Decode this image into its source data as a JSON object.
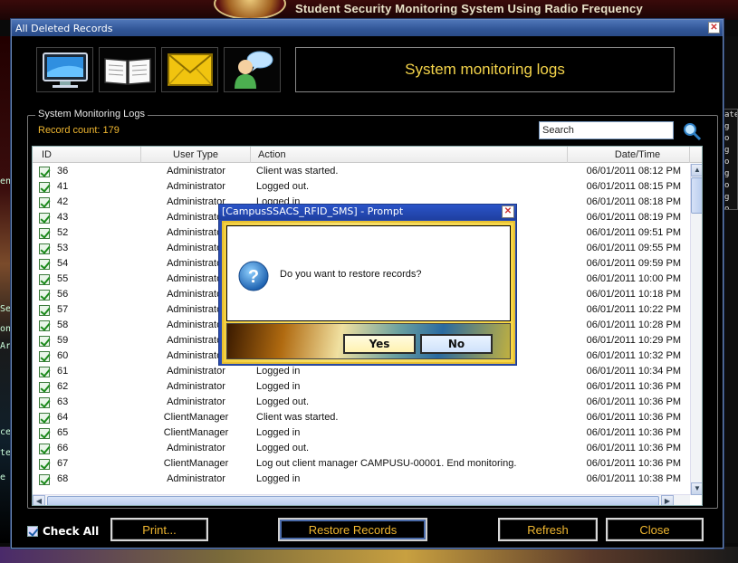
{
  "background": {
    "app_title": "Student Security Monitoring System Using Radio Frequency",
    "left_fragments": [
      "en",
      "Se",
      "on",
      "Ar",
      "ce",
      "te",
      "e"
    ],
    "right_fragments": [
      "ate",
      "g o",
      "g o",
      "g o",
      "g o",
      "g o",
      "g o"
    ]
  },
  "window": {
    "title": "All Deleted Records",
    "close_label": "✕",
    "header_text": "System monitoring logs",
    "toolbar_icons": [
      "monitor-icon",
      "book-icon",
      "envelope-icon",
      "user-chat-icon"
    ]
  },
  "logs": {
    "group_label": "System Monitoring Logs",
    "record_count": "Record count: 179",
    "search_placeholder": "Search",
    "columns": [
      "ID",
      "User Type",
      "Action",
      "Date/Time"
    ],
    "rows": [
      {
        "id": "36",
        "user_type": "Administrator",
        "action": "Client was started.",
        "datetime": "06/01/2011 08:12 PM"
      },
      {
        "id": "41",
        "user_type": "Administrator",
        "action": "Logged out.",
        "datetime": "06/01/2011 08:15 PM"
      },
      {
        "id": "42",
        "user_type": "Administrator",
        "action": "Logged in",
        "datetime": "06/01/2011 08:18 PM"
      },
      {
        "id": "43",
        "user_type": "Administrator",
        "action": "",
        "datetime": "06/01/2011 08:19 PM"
      },
      {
        "id": "52",
        "user_type": "Administrator",
        "action": "",
        "datetime": "06/01/2011 09:51 PM"
      },
      {
        "id": "53",
        "user_type": "Administrator",
        "action": "",
        "datetime": "06/01/2011 09:55 PM"
      },
      {
        "id": "54",
        "user_type": "Administrator",
        "action": "",
        "datetime": "06/01/2011 09:59 PM"
      },
      {
        "id": "55",
        "user_type": "Administrator",
        "action": "",
        "datetime": "06/01/2011 10:00 PM"
      },
      {
        "id": "56",
        "user_type": "Administrator",
        "action": "",
        "datetime": "06/01/2011 10:18 PM"
      },
      {
        "id": "57",
        "user_type": "Administrator",
        "action": "",
        "datetime": "06/01/2011 10:22 PM"
      },
      {
        "id": "58",
        "user_type": "Administrator",
        "action": "",
        "datetime": "06/01/2011 10:28 PM"
      },
      {
        "id": "59",
        "user_type": "Administrator",
        "action": "",
        "datetime": "06/01/2011 10:29 PM"
      },
      {
        "id": "60",
        "user_type": "Administrator",
        "action": "",
        "datetime": "06/01/2011 10:32 PM"
      },
      {
        "id": "61",
        "user_type": "Administrator",
        "action": "Logged in",
        "datetime": "06/01/2011 10:34 PM"
      },
      {
        "id": "62",
        "user_type": "Administrator",
        "action": "Logged in",
        "datetime": "06/01/2011 10:36 PM"
      },
      {
        "id": "63",
        "user_type": "Administrator",
        "action": "Logged out.",
        "datetime": "06/01/2011 10:36 PM"
      },
      {
        "id": "64",
        "user_type": "ClientManager",
        "action": "Client was started.",
        "datetime": "06/01/2011 10:36 PM"
      },
      {
        "id": "65",
        "user_type": "ClientManager",
        "action": "Logged in",
        "datetime": "06/01/2011 10:36 PM"
      },
      {
        "id": "66",
        "user_type": "Administrator",
        "action": "Logged out.",
        "datetime": "06/01/2011 10:36 PM"
      },
      {
        "id": "67",
        "user_type": "ClientManager",
        "action": "Log out client manager CAMPUSU-00001. End monitoring.",
        "datetime": "06/01/2011 10:36 PM"
      },
      {
        "id": "68",
        "user_type": "Administrator",
        "action": "Logged in",
        "datetime": "06/01/2011 10:38 PM"
      }
    ]
  },
  "footer": {
    "check_all_label": "Check All",
    "print_label": "Print...",
    "restore_label": "Restore Records",
    "refresh_label": "Refresh",
    "close_label": "Close"
  },
  "dialog": {
    "title": "[CampusSSACS_RFID_SMS] - Prompt",
    "close_label": "✕",
    "message": "Do you want to restore records?",
    "yes_label": "Yes",
    "no_label": "No",
    "icon": "question-icon"
  },
  "colors": {
    "accent_text": "#f0b730",
    "header_text": "#f3d34a",
    "title_bar": "#305596"
  }
}
